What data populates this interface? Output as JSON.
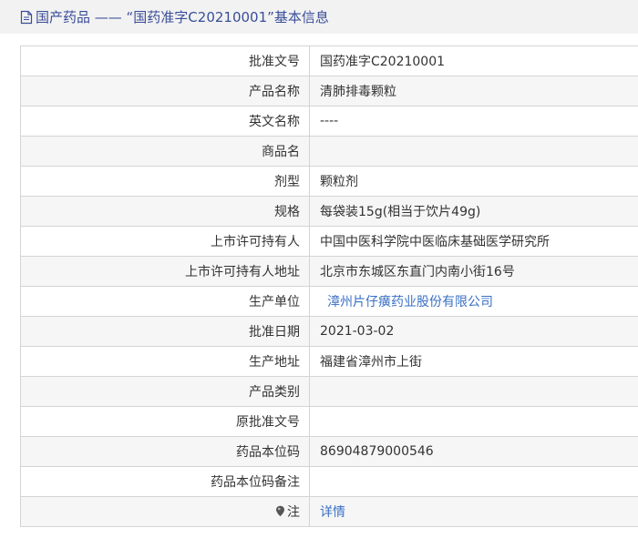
{
  "title": {
    "prefix": "国产药品 —— “国药准字C20210001”基本信息"
  },
  "rows": [
    {
      "label": "批准文号",
      "value": "国药准字C20210001"
    },
    {
      "label": "产品名称",
      "value": "清肺排毒颗粒"
    },
    {
      "label": "英文名称",
      "value": "----"
    },
    {
      "label": "商品名",
      "value": ""
    },
    {
      "label": "剂型",
      "value": "颗粒剂"
    },
    {
      "label": "规格",
      "value": "每袋装15g(相当于饮片49g)"
    },
    {
      "label": "上市许可持有人",
      "value": "中国中医科学院中医临床基础医学研究所"
    },
    {
      "label": "上市许可持有人地址",
      "value": "北京市东城区东直门内南小街16号"
    },
    {
      "label": "生产单位",
      "value": "漳州片仔癀药业股份有限公司"
    },
    {
      "label": "批准日期",
      "value": "2021-03-02"
    },
    {
      "label": "生产地址",
      "value": "福建省漳州市上街"
    },
    {
      "label": "产品类别",
      "value": ""
    },
    {
      "label": "原批准文号",
      "value": ""
    },
    {
      "label": "药品本位码",
      "value": "86904879000546"
    },
    {
      "label": "药品本位码备注",
      "value": ""
    },
    {
      "label": "注",
      "value": "详情"
    }
  ],
  "icons": {
    "title": "document-icon",
    "note": "location-pin-icon"
  },
  "colors": {
    "title_text": "#3a4e99",
    "link": "#3a70c4",
    "title_bar_bg": "#f2f2f2",
    "border": "#d4d4d4",
    "row_alt_bg": "#f6f6f6"
  }
}
